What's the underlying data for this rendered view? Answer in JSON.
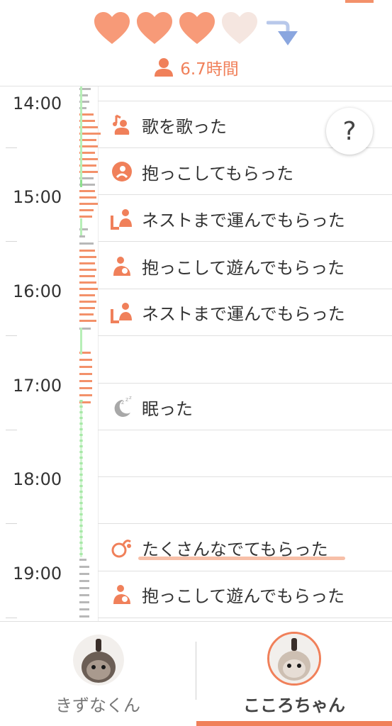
{
  "header": {
    "hearts": [
      {
        "state": "filled",
        "color": "#f79a78"
      },
      {
        "state": "filled",
        "color": "#f79a78"
      },
      {
        "state": "filled",
        "color": "#f79a78"
      },
      {
        "state": "empty",
        "color": "#f5e6e0"
      }
    ],
    "trend_icon": "down-arrow-icon",
    "usage_text": "6.7時間"
  },
  "timeline": {
    "hours": [
      "14:00",
      "15:00",
      "16:00",
      "17:00",
      "18:00",
      "19:00"
    ],
    "events": [
      {
        "icon": "sing-icon",
        "label": "歌を歌った"
      },
      {
        "icon": "hug-icon",
        "label": "抱っこしてもらった"
      },
      {
        "icon": "carry-icon",
        "label": "ネストまで運んでもらった"
      },
      {
        "icon": "hug-play-icon",
        "label": "抱っこして遊んでもらった"
      },
      {
        "icon": "carry-icon",
        "label": "ネストまで運んでもらった"
      },
      {
        "icon": "sleep-icon",
        "label": "眠った"
      },
      {
        "icon": "pet-icon",
        "label": "たくさんなでてもらった"
      },
      {
        "icon": "hug-play-icon",
        "label": "抱っこして遊んでもらった"
      }
    ],
    "help_label": "?"
  },
  "tabs": [
    {
      "label": "きずなくん",
      "active": false
    },
    {
      "label": "こころちゃん",
      "active": true
    }
  ],
  "colors": {
    "accent": "#f0805a",
    "activity": "#f3916a",
    "idle": "#b8b8b8",
    "sleep": "#8ee08e"
  }
}
